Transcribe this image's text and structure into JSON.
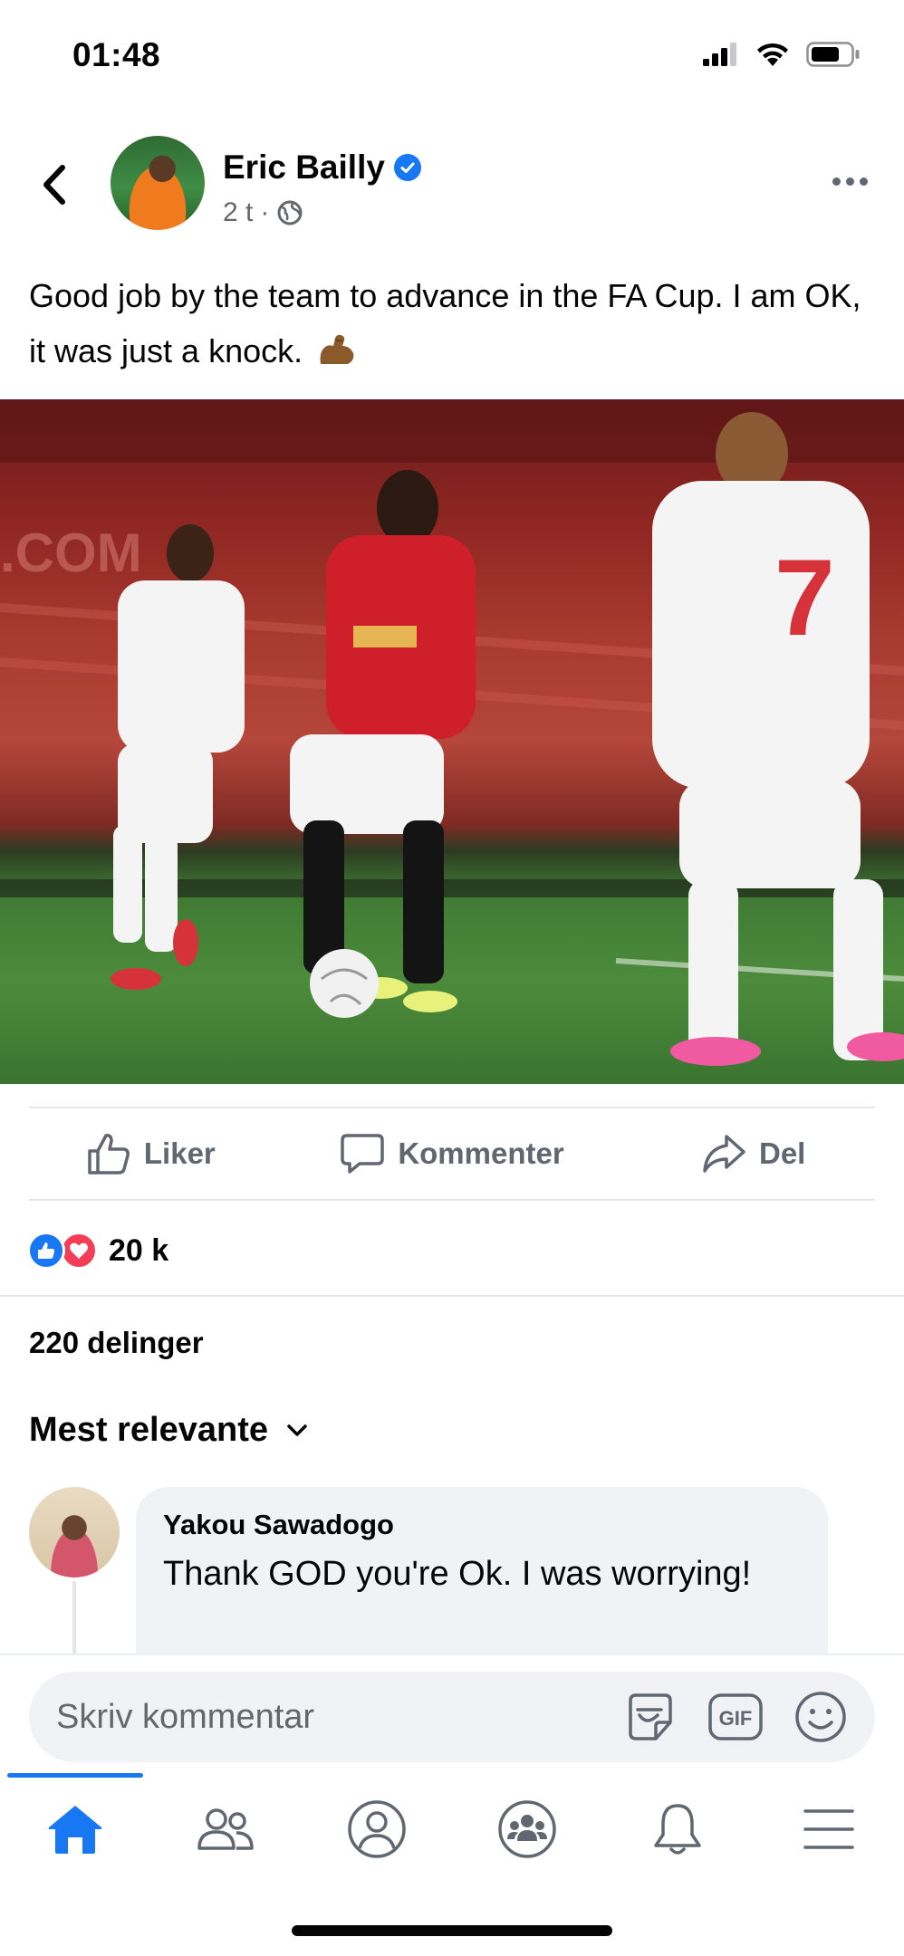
{
  "status_bar": {
    "time": "01:48",
    "icons": [
      "cellular-signal-icon",
      "wifi-icon",
      "battery-icon"
    ]
  },
  "post": {
    "author": "Eric Bailly",
    "verified": true,
    "time_ago": "2 t",
    "separator": "·",
    "audience_icon": "globe-icon",
    "text": "Good job by the team to advance in the FA Cup. I am OK, it was just a knock.",
    "emoji_icon": "flexed-biceps-emoji"
  },
  "actions": {
    "like_label": "Liker",
    "comment_label": "Kommenter",
    "share_label": "Del"
  },
  "reactions": {
    "types": [
      "like",
      "love"
    ],
    "count": "20 k"
  },
  "shares": {
    "label": "220 delinger"
  },
  "comments": {
    "sort_label": "Mest relevante",
    "items": [
      {
        "author": "Yakou Sawadogo",
        "text": "Thank GOD you're Ok. I was worrying!\n\nIf you stay fit till the end of the season"
      }
    ]
  },
  "composer": {
    "placeholder": "Skriv kommentar",
    "gif_label": "GIF"
  },
  "tabbar": {
    "active": "home",
    "tabs": [
      "home-icon",
      "friends-icon",
      "profile-icon",
      "groups-icon",
      "notifications-icon",
      "menu-icon"
    ]
  },
  "colors": {
    "brand_blue": "#1877f2",
    "love_red": "#f33e58",
    "secondary_text": "#65676b",
    "bubble_bg": "#f0f2f5"
  }
}
